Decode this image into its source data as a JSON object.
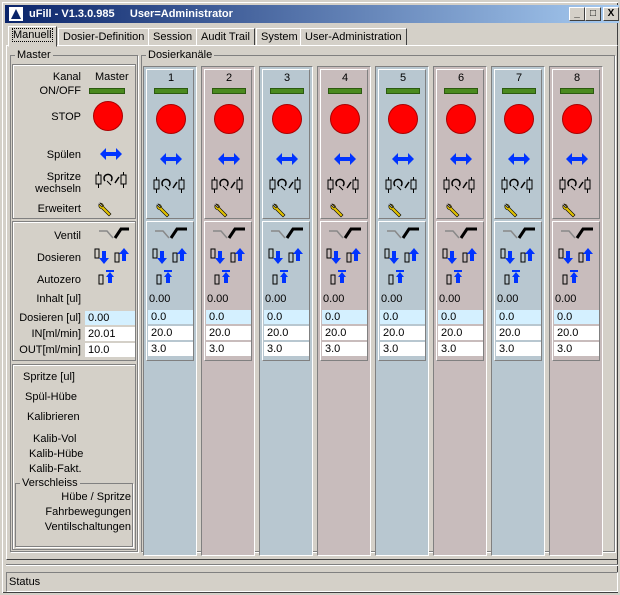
{
  "window": {
    "title": "uFill - V1.3.0.985",
    "user": "User=Administrator",
    "minimize": "_",
    "maximize": "□",
    "close": "X"
  },
  "tabs": [
    {
      "label": "Manuell"
    },
    {
      "label": "Dosier-Definition"
    },
    {
      "label": "Session"
    },
    {
      "label": "Audit Trail"
    },
    {
      "label": "System"
    },
    {
      "label": "User-Administration"
    }
  ],
  "master": {
    "legend": "Master",
    "kanal": "Kanal",
    "master_label": "Master",
    "onoff": "ON/OFF",
    "stop": "STOP",
    "spuelen": "Spülen",
    "spritze_wechseln_1": "Spritze",
    "spritze_wechseln_2": "wechseln",
    "erweitert": "Erweitert",
    "ventil": "Ventil",
    "dosieren": "Dosieren",
    "autozero": "Autozero",
    "inhalt": "Inhalt [ul]",
    "dosieren_ul": "Dosieren [ul]",
    "dosieren_ul_value": "0.00",
    "in": "IN[ml/min]",
    "in_value": "20.01",
    "out": "OUT[ml/min]",
    "out_value": "10.0",
    "spritze_ul": "Spritze [ul]",
    "spuel_huebe": "Spül-Hübe",
    "kalibrieren": "Kalibrieren",
    "kalib_vol": "Kalib-Vol",
    "kalib_huebe": "Kalib-Hübe",
    "kalib_fakt": "Kalib-Fakt.",
    "verschleiss": {
      "legend": "Verschleiss",
      "huebe": "Hübe / Spritze",
      "fahr": "Fahrbewegungen",
      "ventil": "Ventilschaltungen"
    }
  },
  "dosierkanaele": {
    "legend": "Dosierkanäle",
    "channels": [
      {
        "num": "1",
        "inhalt": "0.00",
        "dosieren": "0.0",
        "in": "20.0",
        "out": "3.0"
      },
      {
        "num": "2",
        "inhalt": "0.00",
        "dosieren": "0.0",
        "in": "20.0",
        "out": "3.0"
      },
      {
        "num": "3",
        "inhalt": "0.00",
        "dosieren": "0.0",
        "in": "20.0",
        "out": "3.0"
      },
      {
        "num": "4",
        "inhalt": "0.00",
        "dosieren": "0.0",
        "in": "20.0",
        "out": "3.0"
      },
      {
        "num": "5",
        "inhalt": "0.00",
        "dosieren": "0.0",
        "in": "20.0",
        "out": "3.0"
      },
      {
        "num": "6",
        "inhalt": "0.00",
        "dosieren": "0.0",
        "in": "20.0",
        "out": "3.0"
      },
      {
        "num": "7",
        "inhalt": "0.00",
        "dosieren": "0.0",
        "in": "20.0",
        "out": "3.0"
      },
      {
        "num": "8",
        "inhalt": "0.00",
        "dosieren": "0.0",
        "in": "20.0",
        "out": "3.0"
      }
    ]
  },
  "status": {
    "label": "Status"
  },
  "colors": {
    "led": "#4a8a1e",
    "stop": "#ff0000",
    "arrow": "#0033ff",
    "odd_col": "#b8c7d0",
    "even_col": "#c8bcbc",
    "input_blue": "#d4f0ff"
  }
}
